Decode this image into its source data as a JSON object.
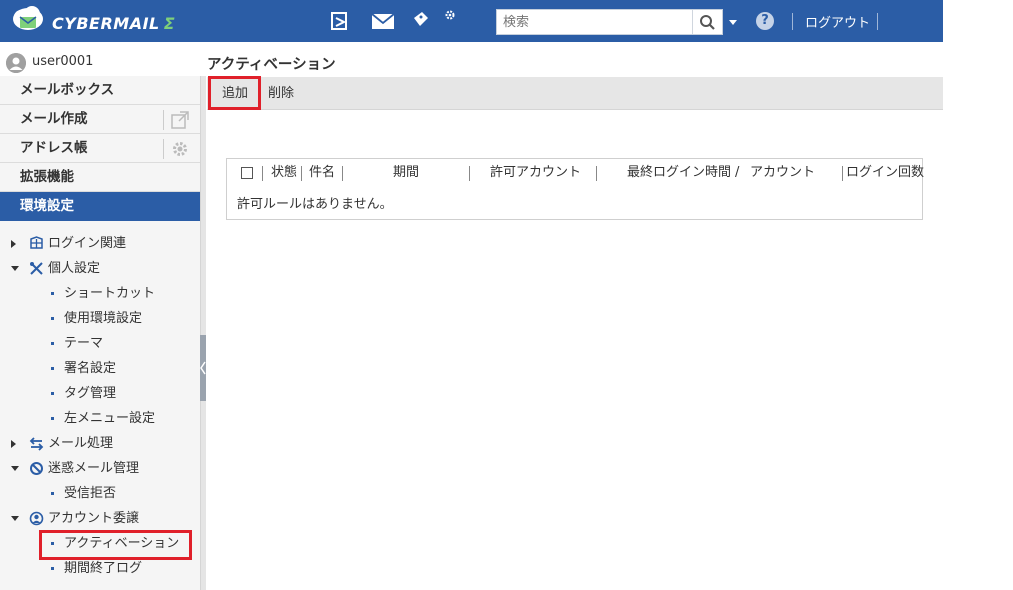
{
  "app": {
    "logo_text": "CYBERMAIL",
    "logo_sigma": "Σ",
    "search_placeholder": "検索",
    "help_label": "?",
    "logout_label": "ログアウト"
  },
  "user": {
    "name": "user0001"
  },
  "sidebar": {
    "items": [
      {
        "label": "メールボックス"
      },
      {
        "label": "メール作成"
      },
      {
        "label": "アドレス帳"
      },
      {
        "label": "拡張機能"
      },
      {
        "label": "環境設定"
      }
    ],
    "tree": {
      "login": "ログイン関連",
      "personal": "個人設定",
      "shortcut": "ショートカット",
      "env": "使用環境設定",
      "theme": "テーマ",
      "signature": "署名設定",
      "tags": "タグ管理",
      "leftmenu": "左メニュー設定",
      "mailproc": "メール処理",
      "spam": "迷惑メール管理",
      "reject": "受信拒否",
      "delegation": "アカウント委譲",
      "activation": "アクティベーション",
      "expiry_log": "期間終了ログ"
    }
  },
  "main": {
    "title": "アクティベーション",
    "toolbar": {
      "add": "追加",
      "delete": "削除"
    },
    "table": {
      "columns": {
        "status": "状態",
        "subject": "件名",
        "period": "期間",
        "allowed_account": "許可アカウント",
        "last_login": "最終ログイン時間",
        "slash": "/",
        "account": "アカウント",
        "login_count": "ログイン回数"
      },
      "empty_message": "許可ルールはありません。"
    }
  },
  "colors": {
    "brand_blue": "#2b5da6",
    "highlight_red": "#e0202a",
    "logo_green": "#7fd07a"
  }
}
